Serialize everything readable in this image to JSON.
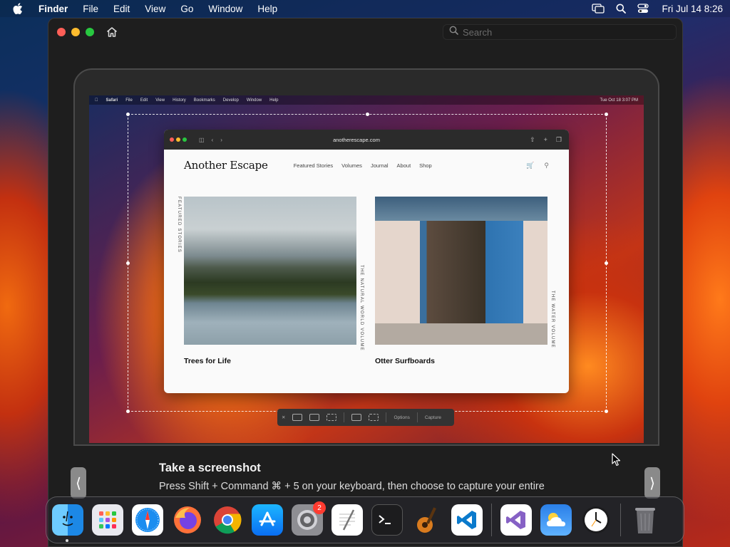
{
  "menubar": {
    "app_name": "Finder",
    "items": [
      "File",
      "Edit",
      "View",
      "Go",
      "Window",
      "Help"
    ],
    "clock": "Fri Jul 14  8:26",
    "status_icons": [
      "screen-mirroring-icon",
      "spotlight-icon",
      "control-center-icon"
    ]
  },
  "window": {
    "search_placeholder": "Search"
  },
  "illustration": {
    "mini_menubar": {
      "items": [
        "Safari",
        "File",
        "Edit",
        "View",
        "History",
        "Bookmarks",
        "Develop",
        "Window",
        "Help"
      ],
      "clock": "Tue Oct 18  3:07 PM"
    },
    "safari": {
      "url": "anotherescape.com",
      "site_title": "Another Escape",
      "nav": [
        "Featured Stories",
        "Volumes",
        "Journal",
        "About",
        "Shop"
      ],
      "cards": [
        {
          "caption": "Trees for Life",
          "side_label": "THE NATURAL WORLD VOLUME"
        },
        {
          "caption": "Otter Surfboards",
          "side_label": "THE WATER VOLUME"
        }
      ],
      "section_label": "FEATURED STORIES"
    },
    "capture_toolbar": {
      "options_label": "Options",
      "capture_label": "Capture"
    }
  },
  "tip": {
    "title": "Take a screenshot",
    "body": "Press Shift + Command ⌘ + 5 on your keyboard, then choose to capture your entire"
  },
  "dock": {
    "apps": [
      "Finder",
      "Launchpad",
      "Safari",
      "Firefox",
      "Google Chrome",
      "App Store",
      "System Settings",
      "TextEdit",
      "Terminal",
      "GarageBand",
      "Visual Studio Code",
      "Visual Studio",
      "Weather",
      "Clock",
      "Trash"
    ],
    "system_settings_badge": "2"
  },
  "colors": {
    "accent_red": "#ff5f57",
    "accent_yellow": "#febc2e",
    "accent_green": "#28c840",
    "window_bg": "#1e1e1e"
  }
}
